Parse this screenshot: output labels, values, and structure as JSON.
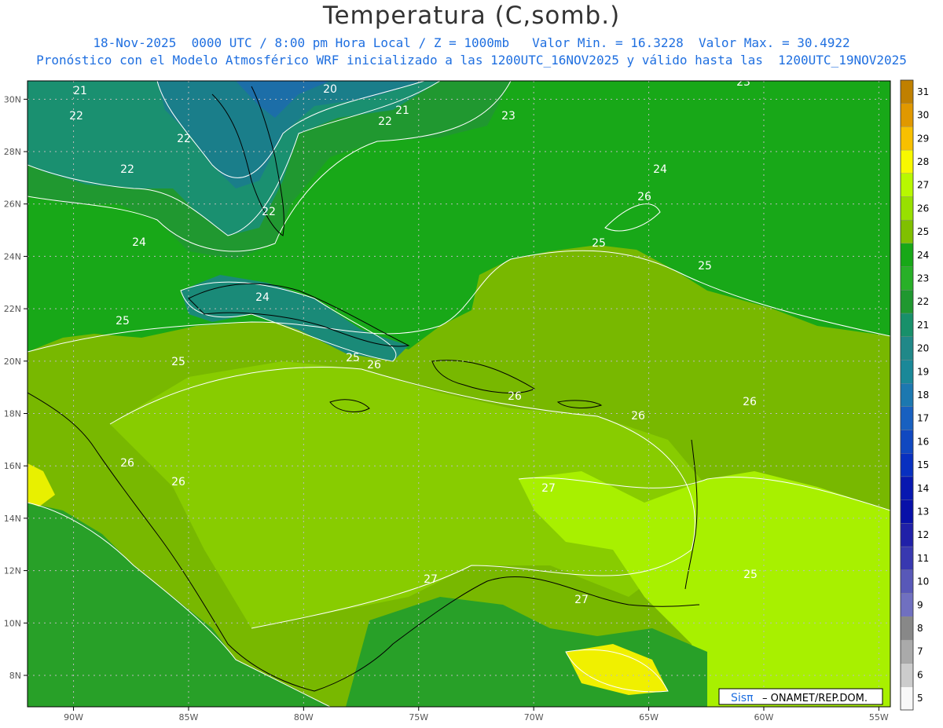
{
  "header": {
    "title": "Temperatura (C,somb.)",
    "line1": "18-Nov-2025  0000 UTC / 8:00 pm Hora Local / Z = 1000mb   Valor Min. = 16.3228  Valor Max. = 30.4922",
    "line2": "Pronóstico con el Modelo Atmosférico WRF inicializado a las 1200UTC_16NOV2025 y válido hasta las  1200UTC_19NOV2025"
  },
  "map": {
    "lat_range": [
      6.8,
      30.7
    ],
    "lon_range": [
      -92,
      -54.5
    ],
    "lat_ticks": [
      "30N",
      "28N",
      "26N",
      "24N",
      "22N",
      "20N",
      "18N",
      "16N",
      "14N",
      "12N",
      "10N",
      "8N"
    ],
    "lon_ticks": [
      "90W",
      "85W",
      "80W",
      "75W",
      "70W",
      "65W",
      "60W",
      "55W"
    ],
    "contour_labels": [
      "21",
      "22",
      "22",
      "22",
      "22",
      "20",
      "21",
      "22",
      "23",
      "23",
      "24",
      "24",
      "24",
      "25",
      "25",
      "25",
      "25",
      "25",
      "26",
      "26",
      "26",
      "26",
      "26",
      "26",
      "26",
      "27",
      "27",
      "27",
      "25"
    ]
  },
  "colorbar": {
    "labels": [
      "31",
      "30",
      "29",
      "28",
      "27",
      "26",
      "25",
      "24",
      "23",
      "22",
      "21",
      "20",
      "19",
      "18",
      "17",
      "16",
      "15",
      "14",
      "13",
      "12",
      "11",
      "10",
      "9",
      "8",
      "7",
      "6",
      "5"
    ],
    "colors": [
      "#c08000",
      "#e09800",
      "#f8c000",
      "#f8f800",
      "#b8f800",
      "#98e000",
      "#80c000",
      "#18a818",
      "#28b028",
      "#209830",
      "#18906a",
      "#208888",
      "#1a8898",
      "#1c78b0",
      "#1860c0",
      "#1048c0",
      "#0830c0",
      "#0818b0",
      "#0810a8",
      "#2020a8",
      "#3838b0",
      "#5858b8",
      "#7070c0",
      "#888888",
      "#aaaaaa",
      "#cccccc",
      "#f8f8f8"
    ]
  },
  "credit": {
    "brand": "Sisπ",
    "org": " – ONAMET/REP.DOM."
  }
}
